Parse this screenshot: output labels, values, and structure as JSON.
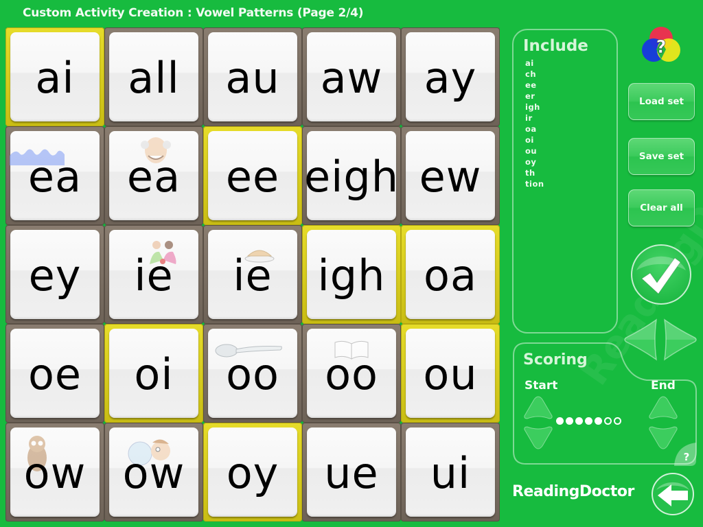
{
  "header": {
    "title": "Custom Activity Creation : Vowel Patterns (Page 2/4)"
  },
  "grid": {
    "tiles": [
      {
        "text": "ai",
        "selected": true,
        "hint": ""
      },
      {
        "text": "all",
        "selected": false,
        "hint": ""
      },
      {
        "text": "au",
        "selected": false,
        "hint": ""
      },
      {
        "text": "aw",
        "selected": false,
        "hint": ""
      },
      {
        "text": "ay",
        "selected": false,
        "hint": ""
      },
      {
        "text": "ea",
        "selected": false,
        "hint": "wave-icon"
      },
      {
        "text": "ea",
        "selected": false,
        "hint": "old-man-icon"
      },
      {
        "text": "ee",
        "selected": true,
        "hint": ""
      },
      {
        "text": "eigh",
        "selected": false,
        "hint": ""
      },
      {
        "text": "ew",
        "selected": false,
        "hint": ""
      },
      {
        "text": "ey",
        "selected": false,
        "hint": ""
      },
      {
        "text": "ie",
        "selected": false,
        "hint": "children-icon"
      },
      {
        "text": "ie",
        "selected": false,
        "hint": "pie-icon"
      },
      {
        "text": "igh",
        "selected": true,
        "hint": ""
      },
      {
        "text": "oa",
        "selected": true,
        "hint": ""
      },
      {
        "text": "oe",
        "selected": false,
        "hint": ""
      },
      {
        "text": "oi",
        "selected": true,
        "hint": ""
      },
      {
        "text": "oo",
        "selected": false,
        "hint": "spoon-icon"
      },
      {
        "text": "oo",
        "selected": false,
        "hint": "book-icon"
      },
      {
        "text": "ou",
        "selected": true,
        "hint": ""
      },
      {
        "text": "ow",
        "selected": false,
        "hint": "owl-icon"
      },
      {
        "text": "ow",
        "selected": false,
        "hint": "bubble-blowing-boy-icon"
      },
      {
        "text": "oy",
        "selected": true,
        "hint": ""
      },
      {
        "text": "ue",
        "selected": false,
        "hint": ""
      },
      {
        "text": "ui",
        "selected": false,
        "hint": ""
      }
    ]
  },
  "include": {
    "title": "Include",
    "items": [
      "ai",
      "ch",
      "ee",
      "er",
      "igh",
      "ir",
      "oa",
      "oi",
      "ou",
      "oy",
      "th",
      "tion"
    ]
  },
  "buttons": {
    "load": "Load set",
    "save": "Save set",
    "clear": "Clear all",
    "help_glyph": "?"
  },
  "scoring": {
    "title": "Scoring",
    "start_label": "Start",
    "end_label": "End",
    "dots_total": 7,
    "dots_filled": 5,
    "help_glyph": "?"
  },
  "brand": {
    "logo_text": "ReadingDoctor",
    "watermark": "ReadingDoctor"
  },
  "colors": {
    "background": "#17bb3f",
    "selected_frame": "#d9cf1e",
    "unselected_frame": "#7a6e62"
  }
}
